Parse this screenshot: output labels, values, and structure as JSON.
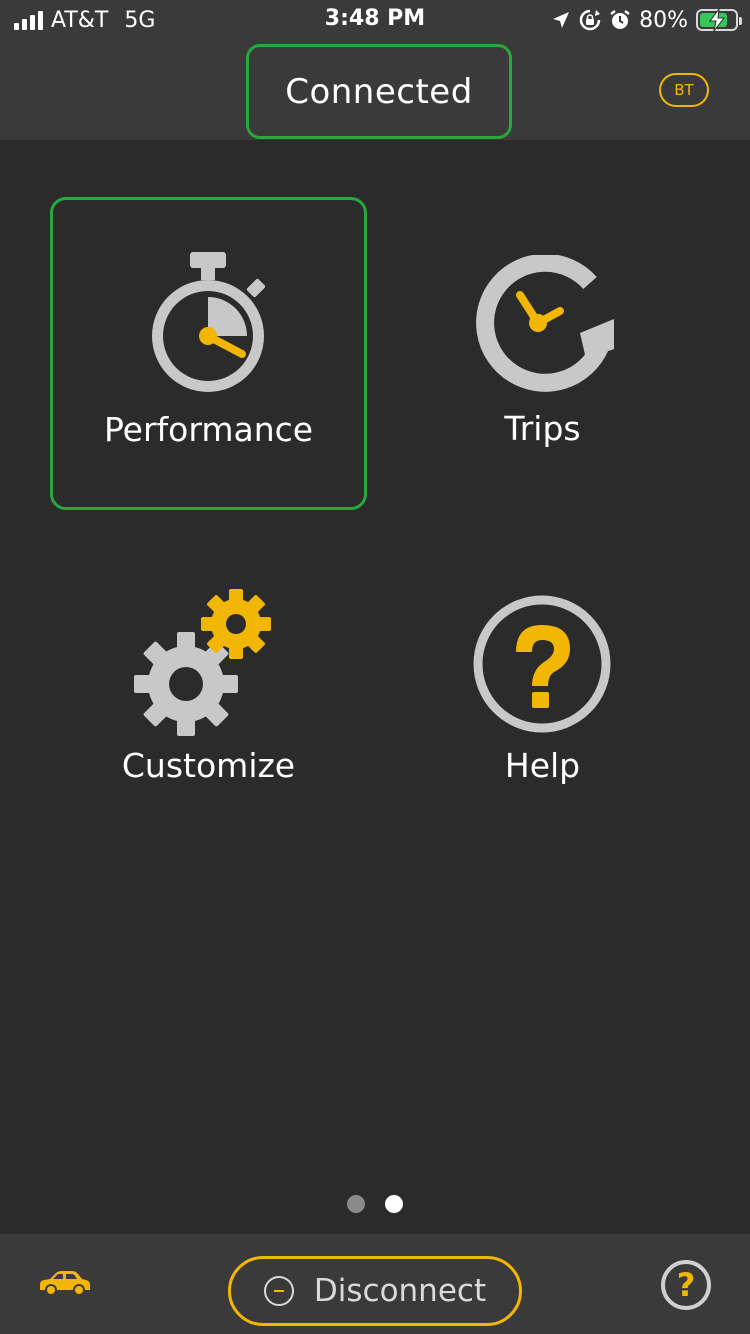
{
  "status_bar": {
    "carrier": "AT&T",
    "network": "5G",
    "time": "3:48 PM",
    "battery_percent": "80%",
    "battery_level": 0.8,
    "icons": [
      "signal-icon",
      "location-arrow-icon",
      "rotation-lock-icon",
      "alarm-icon",
      "battery-charging-icon"
    ]
  },
  "header": {
    "status": "Connected",
    "bt_badge": "BT"
  },
  "tiles": [
    {
      "label": "Performance",
      "icon": "stopwatch-icon"
    },
    {
      "label": "Trips",
      "icon": "clock-refresh-icon"
    },
    {
      "label": "Customize",
      "icon": "gears-icon"
    },
    {
      "label": "Help",
      "icon": "help-circle-icon"
    }
  ],
  "pager": {
    "total": 2,
    "current": 2
  },
  "bottom_bar": {
    "disconnect_label": "Disconnect",
    "help_glyph": "?",
    "icons": [
      "car-icon",
      "minus-circle-icon",
      "help-icon"
    ]
  },
  "colors": {
    "background": "#2b2b2b",
    "bar_background": "#3a3a3a",
    "accent_yellow": "#f2b705",
    "highlight_green": "#26a83c",
    "icon_gray": "#c8c8c8"
  }
}
